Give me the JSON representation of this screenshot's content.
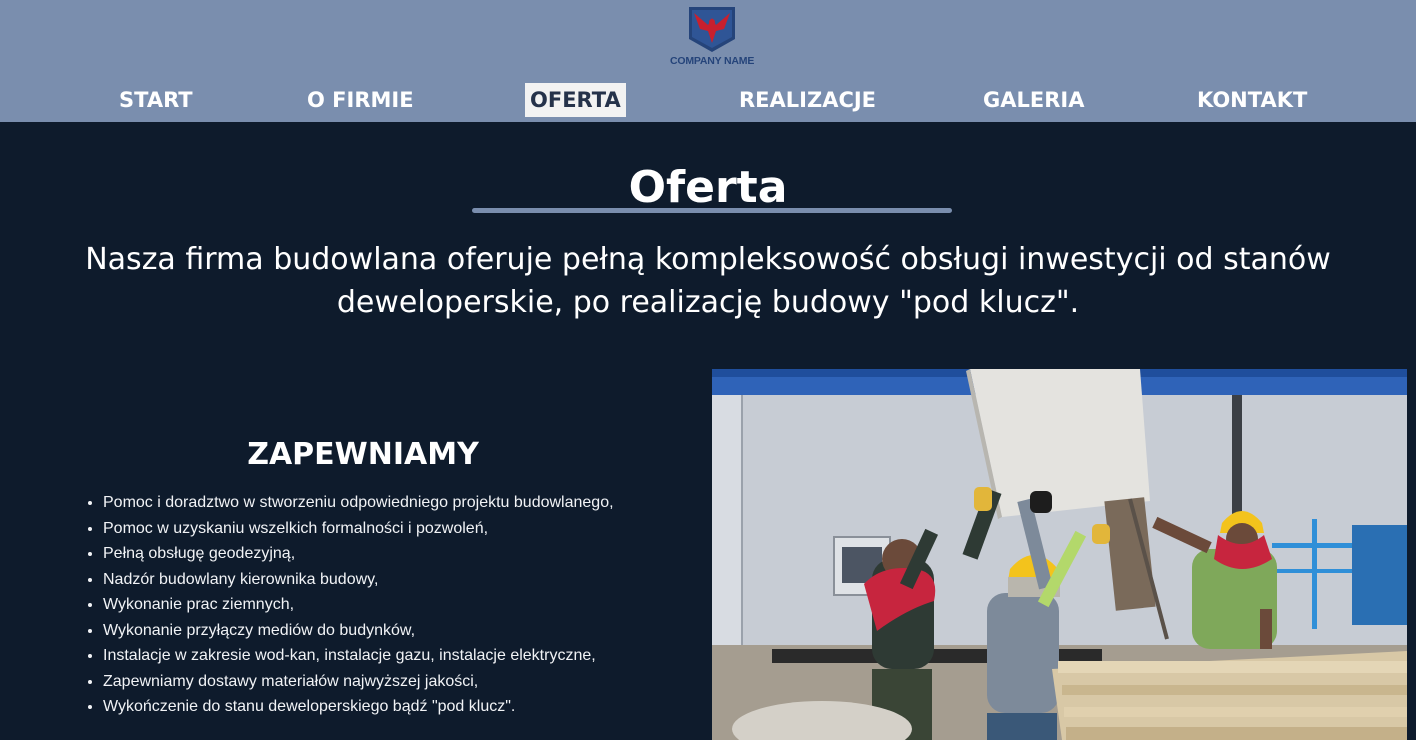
{
  "header": {
    "logo": {
      "text": "COMPANY NAME",
      "icon": "eagle-shield-logo"
    },
    "nav": [
      {
        "label": "START",
        "active": false
      },
      {
        "label": "O FIRMIE",
        "active": false
      },
      {
        "label": "OFERTA",
        "active": true
      },
      {
        "label": "REALIZACJE",
        "active": false
      },
      {
        "label": "GALERIA",
        "active": false
      },
      {
        "label": "KONTAKT",
        "active": false
      }
    ]
  },
  "main": {
    "title": "Oferta",
    "intro": "Nasza firma budowlana oferuje pełną kompleksowość obsługi inwestycji od stanów deweloperskie, po realizację budowy \"pod klucz\".",
    "section_heading": "ZAPEWNIAMY",
    "services": [
      "Pomoc i doradztwo w stworzeniu odpowiedniego projektu budowlanego,",
      "Pomoc w uzyskaniu wszelkich formalności i pozwoleń,",
      "Pełną obsługę geodezyjną,",
      "Nadzór budowlany kierownika budowy,",
      "Wykonanie prac ziemnych,",
      "Wykonanie przyłączy mediów do budynków,",
      "Instalacje w zakresie wod-kan, instalacje gazu, instalacje elektryczne,",
      "Zapewniamy dostawy materiałów najwyższej jakości,",
      "Wykończenie do stanu deweloperskiego bądź \"pod klucz\"."
    ],
    "photo": {
      "subject": "construction-workers-photo"
    }
  },
  "colors": {
    "header_bg": "#7a8eae",
    "page_bg": "#0e1b2c",
    "active_nav_bg": "#f2f2f2",
    "logo_blue": "#25447a",
    "logo_red": "#c8202e"
  }
}
